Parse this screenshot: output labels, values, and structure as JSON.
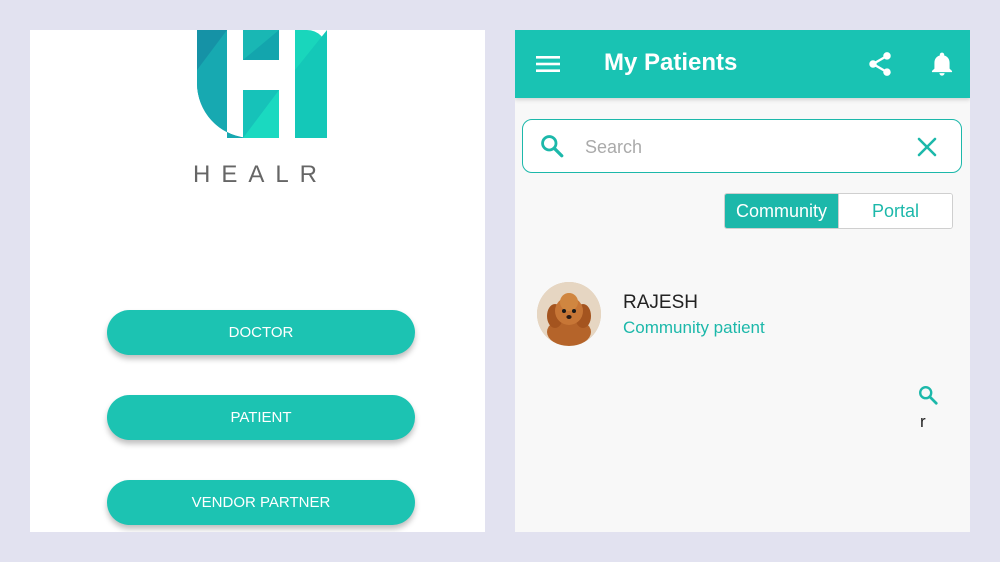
{
  "left_screen": {
    "brand": {
      "name": "HEALR",
      "colors": {
        "dark": "#1592a6",
        "mid": "#14b4b6",
        "light": "#19d6bc"
      }
    },
    "buttons": [
      {
        "label": "DOCTOR"
      },
      {
        "label": "PATIENT"
      },
      {
        "label": "VENDOR PARTNER"
      }
    ],
    "accent_color": "#1cc3b2"
  },
  "right_screen": {
    "app_bar": {
      "title": "My Patients",
      "icons": [
        "menu-icon",
        "share-icon",
        "bell-icon"
      ],
      "color": "#19c3b3"
    },
    "search": {
      "placeholder": "Search",
      "value": "",
      "icons": [
        "search-icon",
        "close-icon"
      ]
    },
    "segments": {
      "options": [
        "Community",
        "Portal"
      ],
      "selected": "Community"
    },
    "patients": [
      {
        "name": "RAJESH",
        "type": "Community patient",
        "avatar": "puppy-photo"
      }
    ],
    "floating": {
      "icon": "search-icon",
      "label": "r"
    },
    "accent_color": "#1cb8aa"
  }
}
